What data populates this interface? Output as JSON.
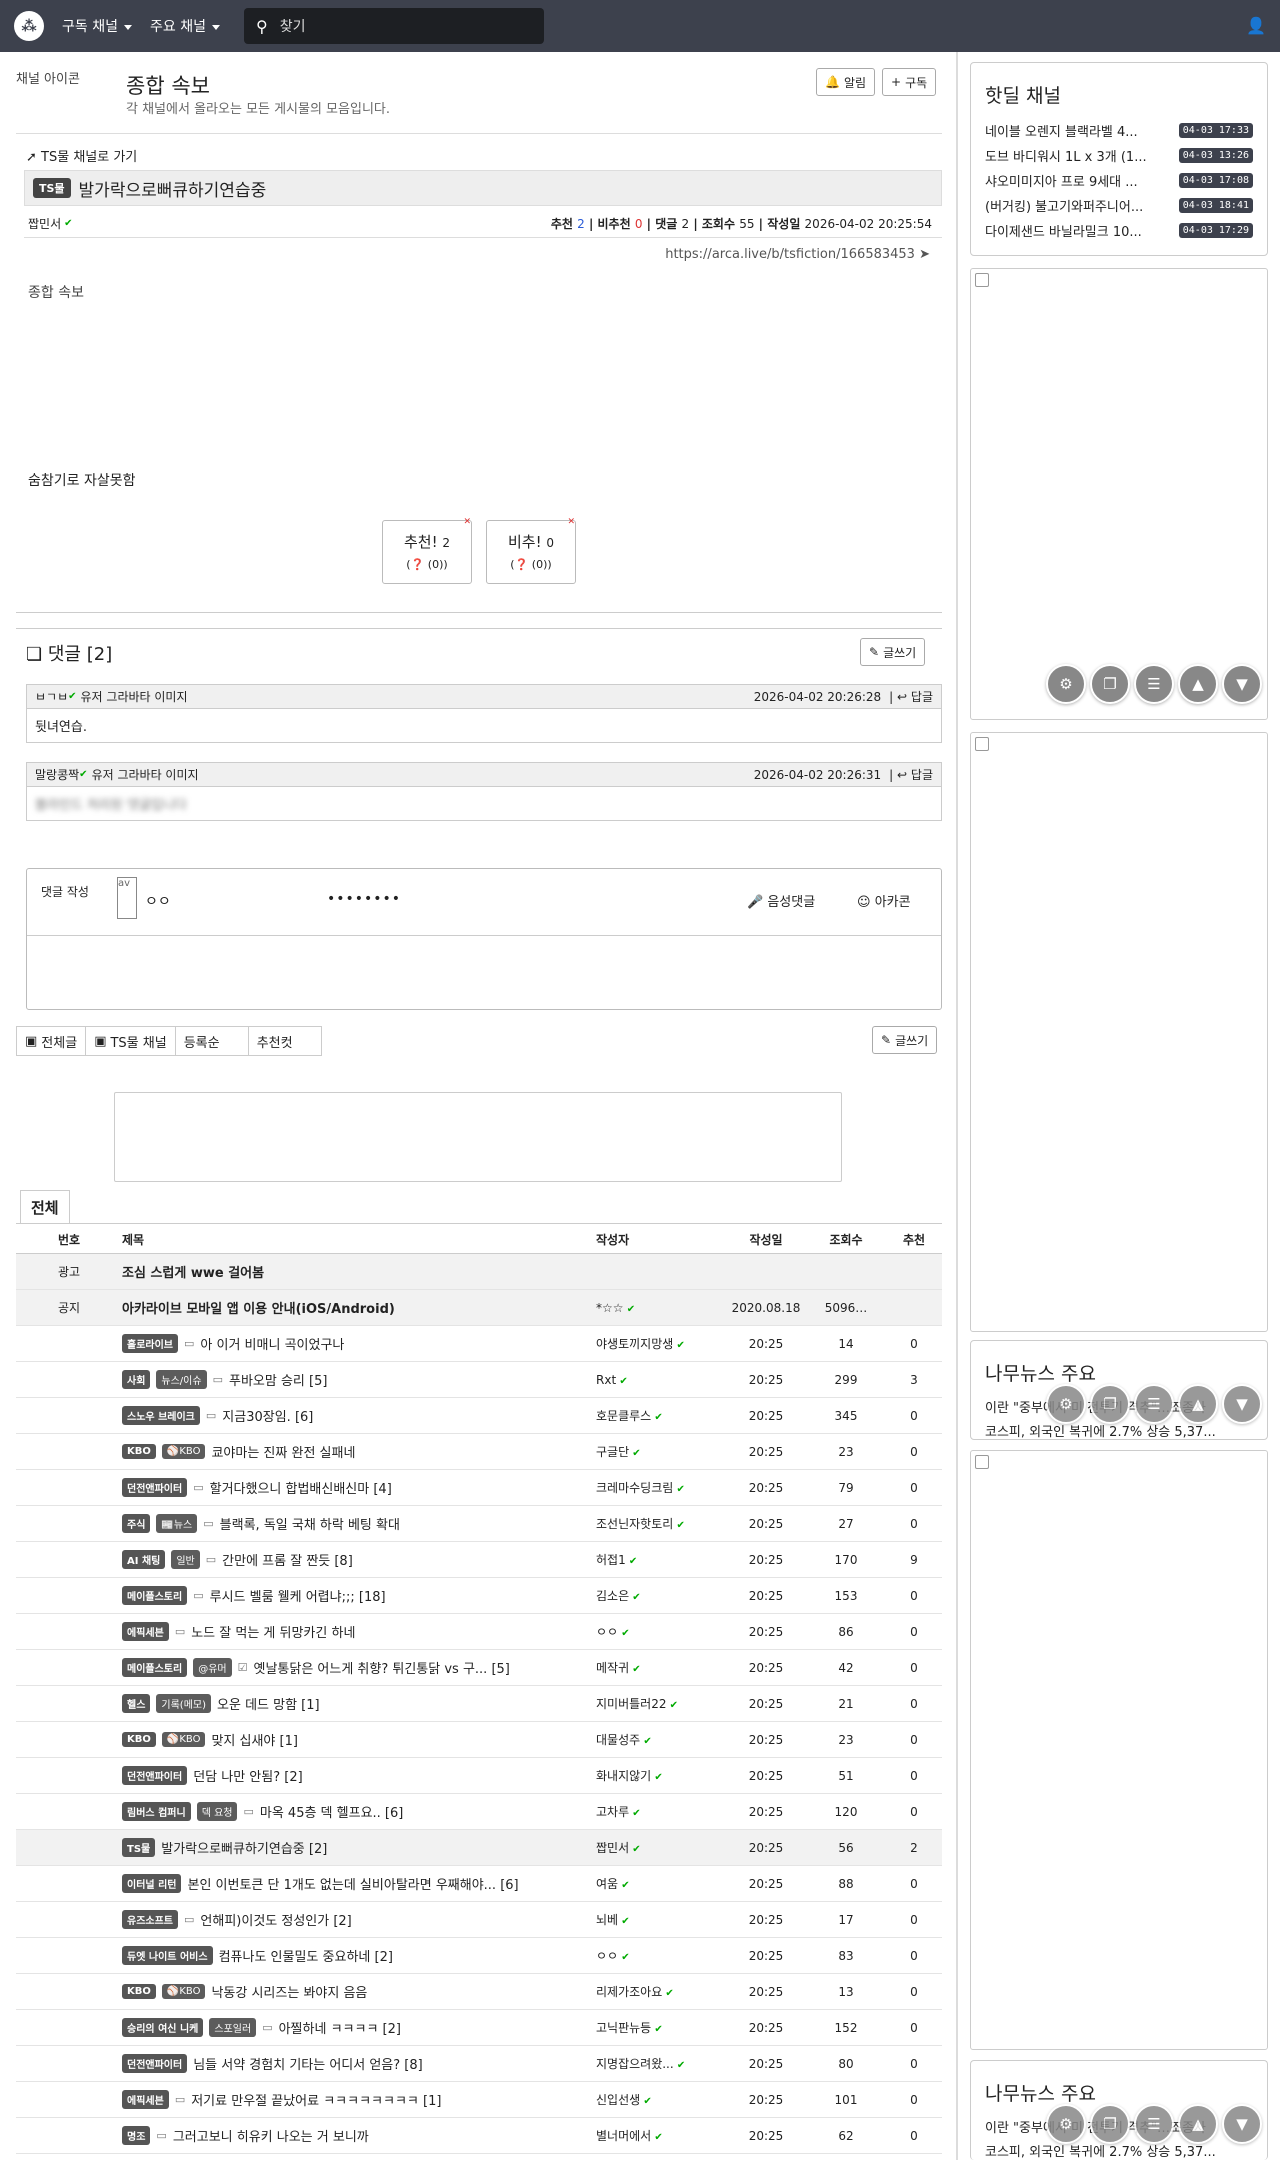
{
  "nav": {
    "menu1": "구독 채널",
    "menu2": "주요 채널",
    "search_placeholder": "찾기",
    "logo": "⁂"
  },
  "channel": {
    "icon_alt": "채널 아이콘",
    "title": "종합 속보",
    "desc": "각 채널에서 올라오는 모든 게시물의 모음입니다.",
    "alarm": "알림",
    "subscribe": "구독"
  },
  "article": {
    "back": "TS물 채널로 가기",
    "badge": "TS물",
    "title": "발가락으로뻐큐하기연습중",
    "author": "짭민서",
    "rec_label": "추천",
    "rec": "2",
    "unrec_label": "비추천",
    "unrec": "0",
    "comments_label": "댓글",
    "comments": "2",
    "views_label": "조회수",
    "views": "55",
    "date_label": "작성일",
    "date": "2026-04-02 20:25:54",
    "url": "https://arca.live/b/tsfiction/166583453",
    "img_alt": "종합 속보",
    "body": "숨참기로 자살못함",
    "vote_up": "추천!",
    "vote_up_count": "2",
    "vote_up_sub": "(0)",
    "vote_down": "비추!",
    "vote_down_count": "0",
    "vote_down_sub": "(0)"
  },
  "comments": {
    "header": "댓글 [2]",
    "write": "글쓰기",
    "items": [
      {
        "author": "ㅂㄱㅂ",
        "avatar_alt": "유저 그라바타 이미지",
        "date": "2026-04-02 20:26:28",
        "reply": "답글",
        "text": "뒷녀연습."
      },
      {
        "author": "말랑콩짝",
        "avatar_alt": "유저 그라바타 이미지",
        "date": "2026-04-02 20:26:31",
        "reply": "답글",
        "text": "블라인드 처리된 댓글입니다"
      }
    ]
  },
  "comment_form": {
    "label": "댓글 작성",
    "avatar": "av",
    "nick": "ㅇㅇ",
    "password": "••••••••",
    "voice": "음성댓글",
    "emoticon": "아카콘"
  },
  "filters": [
    "전체글",
    "TS물 채널",
    "등록순",
    "추천컷"
  ],
  "list": {
    "tab": "전체",
    "headers": {
      "no": "번호",
      "title": "제목",
      "author": "작성자",
      "date": "작성일",
      "views": "조회수",
      "rec": "추천"
    },
    "rows": [
      {
        "no": "광고",
        "title": "조심 스럽게 wwe 걸어봄",
        "bold": true,
        "gray": true
      },
      {
        "no": "공지",
        "title": "아카라이브 모바일 앱 이용 안내(iOS/Android)",
        "bold": true,
        "gray": true,
        "author": "*☆☆",
        "date": "2020.08.18",
        "views": "5096…"
      },
      {
        "tags": [
          "홀로라이브"
        ],
        "icon": "img",
        "title": "아 이거 비매니 곡이었구나",
        "author": "야생토끼지망생",
        "date": "20:25",
        "views": "14",
        "rec": "0"
      },
      {
        "tags": [
          "사회",
          "뉴스/이슈"
        ],
        "icon": "img",
        "title": "푸바오맘 승리 [5]",
        "author": "Rxt",
        "date": "20:25",
        "views": "299",
        "rec": "3"
      },
      {
        "tags": [
          "스노우 브레이크"
        ],
        "icon": "img",
        "title": "지금30장임. [6]",
        "author": "호문클루스",
        "date": "20:25",
        "views": "345",
        "rec": "0"
      },
      {
        "tags": [
          "KBO",
          "⚾KBO"
        ],
        "title": "쿄야마는 진짜 완전 실패네",
        "author": "구글단",
        "date": "20:25",
        "views": "23",
        "rec": "0"
      },
      {
        "tags": [
          "던전앤파이터"
        ],
        "icon": "img",
        "title": "할거다했으니 합법배신배신마 [4]",
        "author": "크레마수딩크림",
        "date": "20:25",
        "views": "79",
        "rec": "0"
      },
      {
        "tags": [
          "주식",
          "📰뉴스"
        ],
        "icon": "img",
        "title": "블랙록, 독일 국채 하락 베팅 확대",
        "author": "조선닌자핫토리",
        "date": "20:25",
        "views": "27",
        "rec": "0"
      },
      {
        "tags": [
          "AI 채팅",
          "일반"
        ],
        "icon": "img",
        "title": "간만에 프롬 잘 짠듯 [8]",
        "author": "허접1",
        "date": "20:25",
        "views": "170",
        "rec": "9"
      },
      {
        "tags": [
          "메이플스토리"
        ],
        "icon": "img",
        "title": "루시드 벨룸 웰케 어렵냐;;; [18]",
        "author": "김소은",
        "date": "20:25",
        "views": "153",
        "rec": "0"
      },
      {
        "tags": [
          "에픽세븐"
        ],
        "icon": "img",
        "title": "노드 잘 먹는 게 뒤망카긴 하네",
        "author": "ㅇㅇ",
        "date": "20:25",
        "views": "86",
        "rec": "0"
      },
      {
        "tags": [
          "메이플스토리",
          "@유머"
        ],
        "icon": "vote",
        "title": "옛날통닭은 어느게 취향? 튀긴통닭 vs 구... [5]",
        "author": "메작귀",
        "date": "20:25",
        "views": "42",
        "rec": "0"
      },
      {
        "tags": [
          "헬스",
          "기록(메모)"
        ],
        "title": "오운 데드 망함 [1]",
        "author": "지미버틀러22",
        "date": "20:25",
        "views": "21",
        "rec": "0"
      },
      {
        "tags": [
          "KBO",
          "⚾KBO"
        ],
        "title": "맞지 십새야 [1]",
        "author": "대물성주",
        "date": "20:25",
        "views": "23",
        "rec": "0"
      },
      {
        "tags": [
          "던전앤파이터"
        ],
        "title": "던담 나만 안됨? [2]",
        "author": "화내지않기",
        "date": "20:25",
        "views": "51",
        "rec": "0"
      },
      {
        "tags": [
          "림버스 컴퍼니",
          "덱 요청"
        ],
        "icon": "img",
        "title": "마옥 45층 덱 헬프요.. [6]",
        "author": "고차루",
        "date": "20:25",
        "views": "120",
        "rec": "0"
      },
      {
        "tags": [
          "TS물"
        ],
        "title": "발가락으로뻐큐하기연습중 [2]",
        "author": "짭민서",
        "date": "20:25",
        "views": "56",
        "rec": "2",
        "gray": true
      },
      {
        "tags": [
          "이터널 리턴"
        ],
        "title": "본인 이번토큰 단 1개도 없는데 실비아탈라면 우째해야... [6]",
        "author": "여움",
        "date": "20:25",
        "views": "88",
        "rec": "0"
      },
      {
        "tags": [
          "유즈소프트"
        ],
        "icon": "img",
        "title": "언해피)이것도 정성인가 [2]",
        "author": "뇌베",
        "date": "20:25",
        "views": "17",
        "rec": "0"
      },
      {
        "tags": [
          "듀엣 나이트 어비스"
        ],
        "title": "컴퓨나도 인물밀도 중요하네 [2]",
        "author": "ㅇㅇ",
        "date": "20:25",
        "views": "83",
        "rec": "0"
      },
      {
        "tags": [
          "KBO",
          "⚾KBO"
        ],
        "title": "낙동강 시리즈는 봐야지 음음",
        "author": "리제가조아요",
        "date": "20:25",
        "views": "13",
        "rec": "0"
      },
      {
        "tags": [
          "승리의 여신 니케",
          "스포일러"
        ],
        "icon": "img",
        "title": "아찔하네 ㅋㅋㅋㅋ [2]",
        "author": "고닉판뉴등",
        "date": "20:25",
        "views": "152",
        "rec": "0"
      },
      {
        "tags": [
          "던전앤파이터"
        ],
        "title": "님들 서약 경험치 기타는 어디서 얻음? [8]",
        "author": "지명잡으려왔...",
        "date": "20:25",
        "views": "80",
        "rec": "0"
      },
      {
        "tags": [
          "에픽세븐"
        ],
        "icon": "img",
        "title": "저기료 만우절 끝났어료 ㅋㅋㅋㅋㅋㅋㅋㅋ [1]",
        "author": "신입선생",
        "date": "20:25",
        "views": "101",
        "rec": "0"
      },
      {
        "tags": [
          "명조"
        ],
        "icon": "img",
        "title": "그러고보니 히유키 나오는 거 보니까",
        "author": "별너머에서",
        "date": "20:25",
        "views": "62",
        "rec": "0"
      }
    ]
  },
  "hotdeal": {
    "title": "핫딜 채널",
    "items": [
      {
        "t": "네이블 오렌지 블랙라벨 4...",
        "d": "04-03 17:33"
      },
      {
        "t": "도브 바디워시 1L x 3개 (1...",
        "d": "04-03 13:26"
      },
      {
        "t": "샤오미미지아 프로 9세대 ...",
        "d": "04-03 17:08"
      },
      {
        "t": "(버거킹) 불고기와퍼주니어...",
        "d": "04-03 18:41"
      },
      {
        "t": "다이제샌드 바닐라밀크 10...",
        "d": "04-03 17:29"
      }
    ]
  },
  "news": {
    "title": "나무뉴스 주요",
    "items": [
      "이란 \"중부에서 미 전투기 격추\"…조종사",
      "코스피, 외국인 복귀에 2.7% 상승 5,37..."
    ]
  }
}
